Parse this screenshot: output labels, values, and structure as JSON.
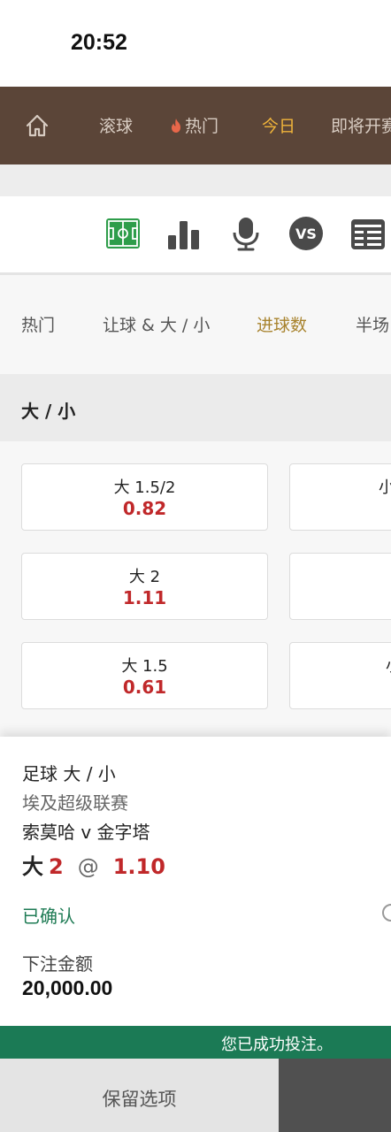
{
  "status_bar": {
    "time": "20:52"
  },
  "nav": {
    "items": [
      {
        "label": "滚球"
      },
      {
        "label": "热门"
      },
      {
        "label": "今日"
      },
      {
        "label": "即将开赛"
      }
    ],
    "active_index": 2
  },
  "toolbar": {
    "icons": [
      "pitch-icon",
      "stats-bar-icon",
      "microphone-icon",
      "vs-icon",
      "scoreboard-icon"
    ],
    "active_color": "#2e9d4a",
    "icon_color": "#4a4a4a"
  },
  "market_tabs": {
    "items": [
      {
        "label": "热门"
      },
      {
        "label": "让球 & 大 / 小"
      },
      {
        "label": "进球数"
      },
      {
        "label": "半场"
      }
    ],
    "active_index": 2
  },
  "section": {
    "title": "大 / 小"
  },
  "odds": {
    "rows": [
      {
        "over_label": "大 1.5/2",
        "over_odds": "0.82",
        "under_label": "小"
      },
      {
        "over_label": "大 2",
        "over_odds": "1.11",
        "under_label": ""
      },
      {
        "over_label": "大 1.5",
        "over_odds": "0.61",
        "under_label": "小"
      }
    ]
  },
  "bet_slip": {
    "sport_market": "足球 大 / 小",
    "league": "埃及超级联赛",
    "match": "索莫哈 v 金字塔",
    "selection_side": "大",
    "selection_line": "2",
    "selection_at": "@",
    "selection_odds": "1.10",
    "status": "已确认",
    "stake_label": "下注金额",
    "stake_value": "20,000.00"
  },
  "success_message": "您已成功投注。",
  "footer": {
    "keep_label": "保留选项"
  },
  "colors": {
    "nav_bg": "#5b4538",
    "nav_active": "#f0b43a",
    "odds_red": "#c0282a",
    "success_green": "#1b7a55",
    "tab_active": "#a8832e"
  }
}
